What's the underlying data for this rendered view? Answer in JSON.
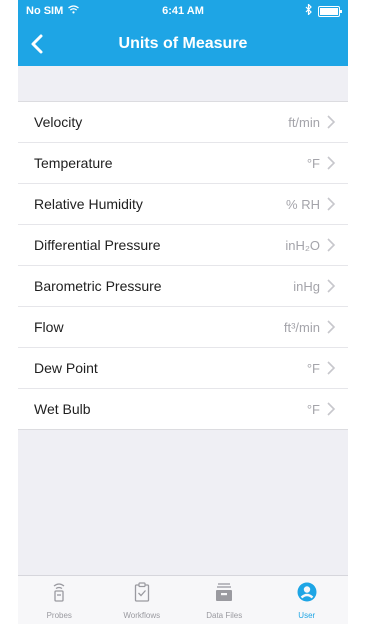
{
  "status_bar": {
    "carrier": "No SIM",
    "time": "6:41 AM"
  },
  "header": {
    "title": "Units of Measure",
    "back_icon": "chevron-left-icon",
    "background": "#1ea5e5"
  },
  "units": [
    {
      "label": "Velocity",
      "value": "ft/min"
    },
    {
      "label": "Temperature",
      "value": "°F"
    },
    {
      "label": "Relative Humidity",
      "value": "% RH"
    },
    {
      "label": "Differential Pressure",
      "value": "inH₂O"
    },
    {
      "label": "Barometric Pressure",
      "value": "inHg"
    },
    {
      "label": "Flow",
      "value": "ft³/min"
    },
    {
      "label": "Dew Point",
      "value": "°F"
    },
    {
      "label": "Wet Bulb",
      "value": "°F"
    }
  ],
  "tabs": [
    {
      "label": "Probes",
      "icon": "probe-icon",
      "active": false
    },
    {
      "label": "Workflows",
      "icon": "clipboard-check-icon",
      "active": false
    },
    {
      "label": "Data Files",
      "icon": "data-files-icon",
      "active": false
    },
    {
      "label": "User",
      "icon": "user-icon",
      "active": true
    }
  ],
  "colors": {
    "accent": "#1ea5e5",
    "inactive_tab": "#9a9aa0"
  }
}
